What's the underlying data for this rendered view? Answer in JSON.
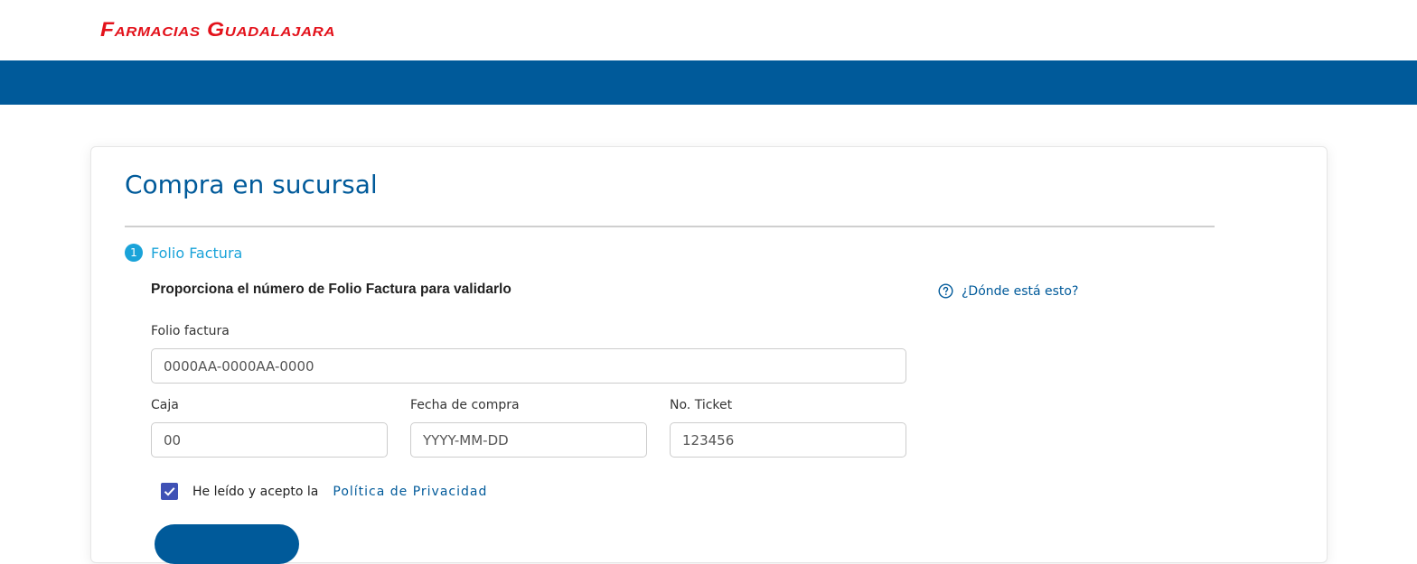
{
  "brand": {
    "logo_text": "Farmacias Guadalajara",
    "logo_color": "#e3121b",
    "primary_color": "#005a9a",
    "accent_color": "#1aa3d9"
  },
  "card": {
    "title": "Compra en sucursal"
  },
  "step": {
    "number": "1",
    "label": "Folio Factura"
  },
  "instructions": "Proporciona el número de Folio Factura para validarlo",
  "help": {
    "icon": "question-circle-icon",
    "label": "¿Dónde está esto?"
  },
  "fields": {
    "folio": {
      "label": "Folio factura",
      "placeholder": "0000AA-0000AA-0000"
    },
    "caja": {
      "label": "Caja",
      "placeholder": "00"
    },
    "fecha": {
      "label": "Fecha de compra",
      "placeholder": "YYYY-MM-DD"
    },
    "ticket": {
      "label": "No. Ticket",
      "placeholder": "123456"
    }
  },
  "consent": {
    "checked": true,
    "text": "He leído y acepto la",
    "link": "Política de Privacidad"
  }
}
